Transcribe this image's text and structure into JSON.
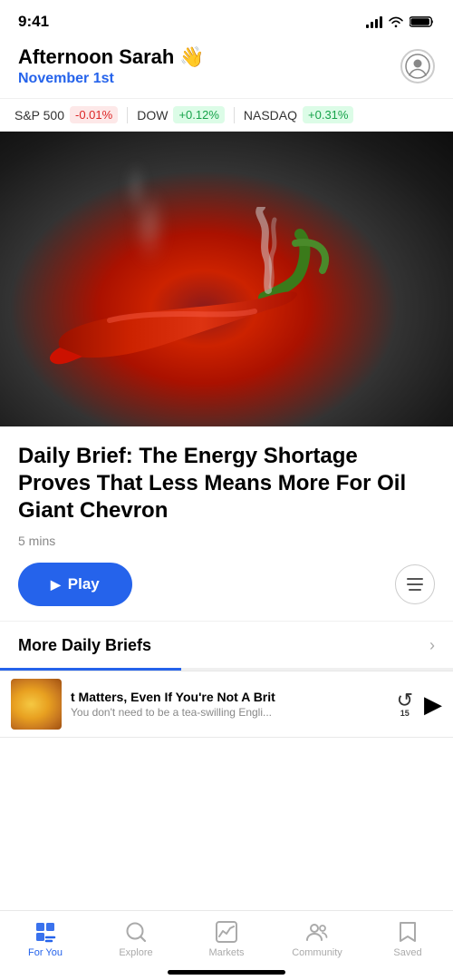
{
  "statusBar": {
    "time": "9:41",
    "signalBars": [
      4,
      7,
      10,
      13
    ],
    "wifiLabel": "wifi",
    "batteryLabel": "battery"
  },
  "header": {
    "greetingPrefix": "Afternoon Sarah",
    "greetingEmoji": "👋",
    "date": "November 1st",
    "profileIcon": "person-circle"
  },
  "marketTicker": [
    {
      "name": "S&P 500",
      "value": "-0.01%",
      "positive": false
    },
    {
      "name": "DOW",
      "value": "+0.12%",
      "positive": true
    },
    {
      "name": "NASDAQ",
      "value": "+0.31%",
      "positive": true
    }
  ],
  "article": {
    "title": "Daily Brief: The Energy Shortage Proves That Less Means More For Oil Giant Chevron",
    "readTime": "5 mins",
    "playLabel": "Play",
    "playIcon": "▶"
  },
  "moreSection": {
    "label": "More Daily Briefs"
  },
  "miniPlayer": {
    "title": "t Matters, Even If You're Not A Brit",
    "subtitle": "You don't need to be a tea-swilling Engli...",
    "backSeconds": "15",
    "playIcon": "▶"
  },
  "bottomNav": {
    "items": [
      {
        "id": "for-you",
        "label": "For You",
        "active": true
      },
      {
        "id": "explore",
        "label": "Explore",
        "active": false
      },
      {
        "id": "markets",
        "label": "Markets",
        "active": false
      },
      {
        "id": "community",
        "label": "Community",
        "active": false
      },
      {
        "id": "saved",
        "label": "Saved",
        "active": false
      }
    ]
  },
  "colors": {
    "accent": "#2563eb",
    "positive": "#16a34a",
    "negative": "#dc2626",
    "positiveBg": "#dcfce7",
    "negativeBg": "#fde8e8"
  }
}
